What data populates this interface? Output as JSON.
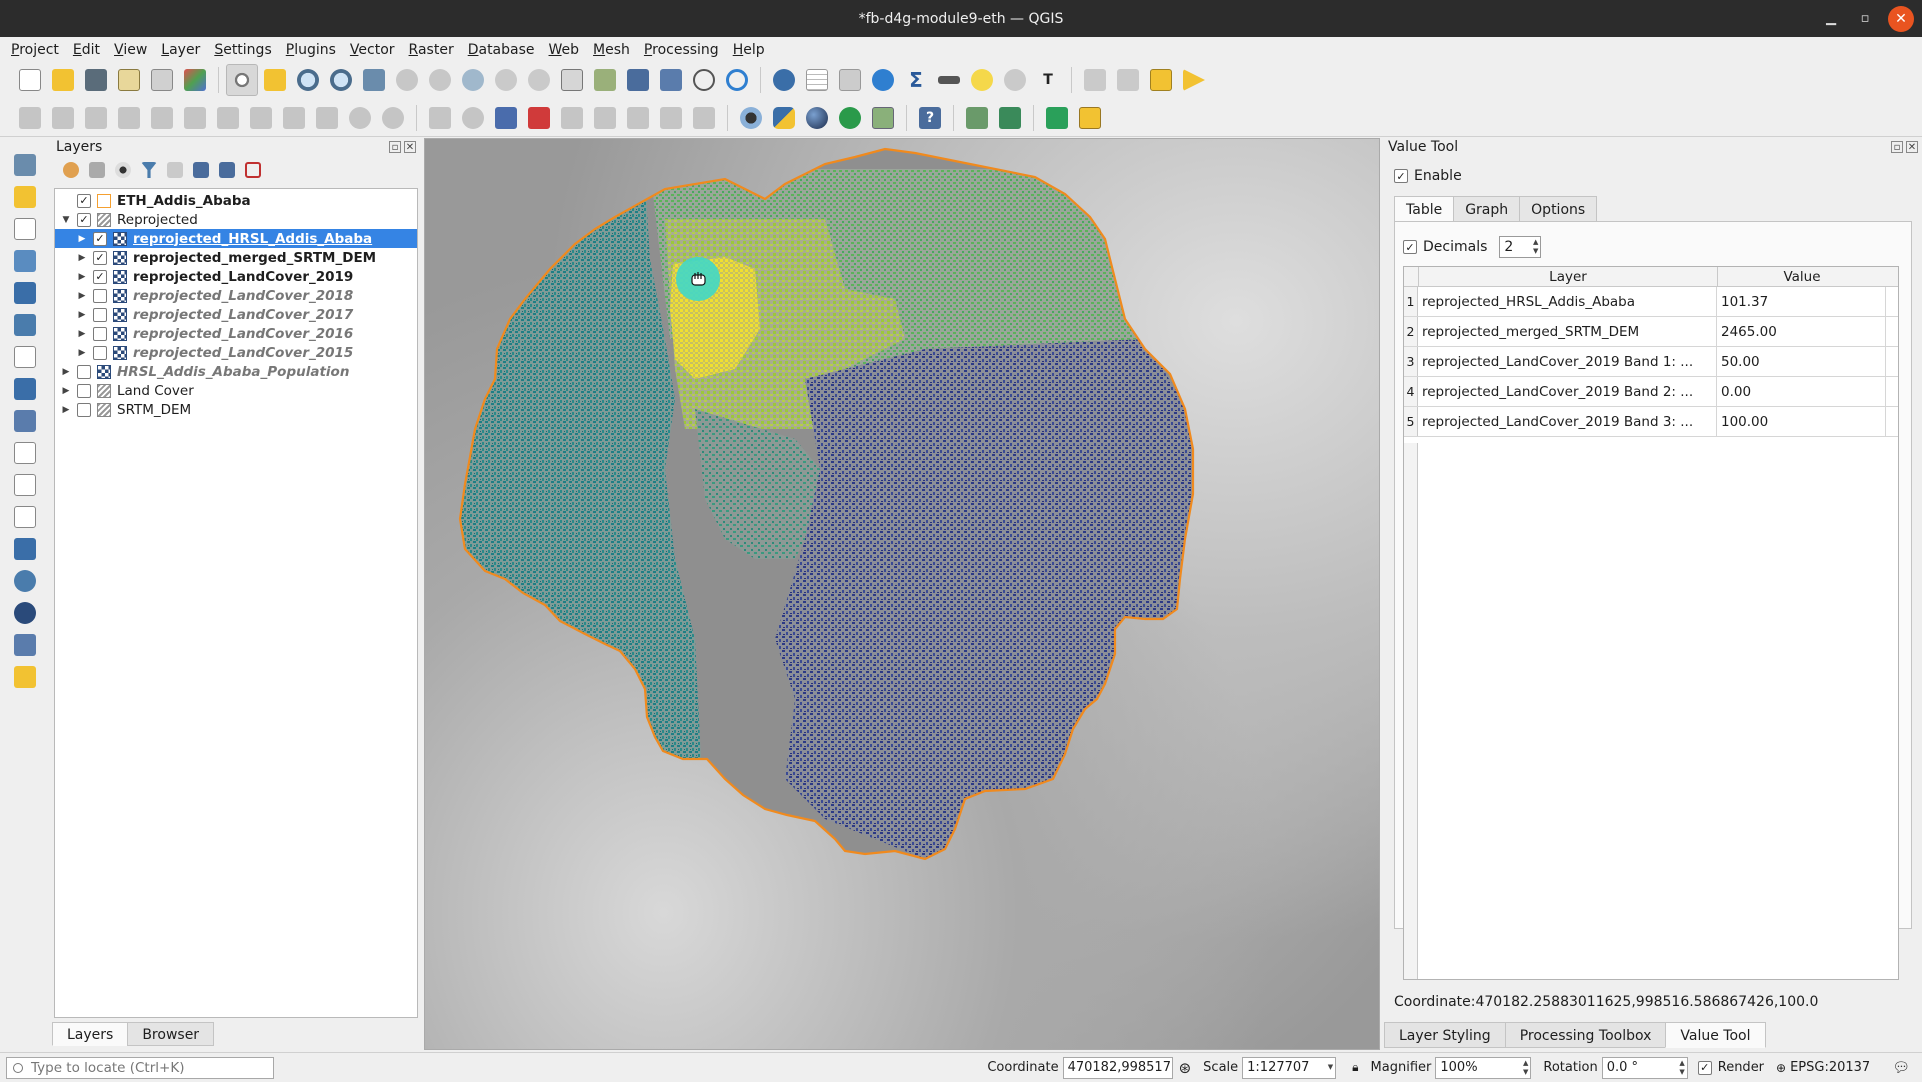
{
  "window": {
    "title": "*fb-d4g-module9-eth — QGIS"
  },
  "menu": [
    "Project",
    "Edit",
    "View",
    "Layer",
    "Settings",
    "Plugins",
    "Vector",
    "Raster",
    "Database",
    "Web",
    "Mesh",
    "Processing",
    "Help"
  ],
  "layers_panel": {
    "title": "Layers",
    "tree": [
      {
        "name": "ETH_Addis_Ababa",
        "checked": true,
        "type": "vector",
        "style": "bold",
        "indent": 0,
        "expander": ""
      },
      {
        "name": "Reprojected",
        "checked": true,
        "type": "group",
        "style": "normal",
        "indent": 0,
        "expander": "▼"
      },
      {
        "name": "reprojected_HRSL_Addis_Ababa",
        "checked": true,
        "type": "raster",
        "style": "bold",
        "indent": 1,
        "expander": "▶",
        "selected": true
      },
      {
        "name": "reprojected_merged_SRTM_DEM",
        "checked": true,
        "type": "raster",
        "style": "bold",
        "indent": 1,
        "expander": "▶"
      },
      {
        "name": "reprojected_LandCover_2019",
        "checked": true,
        "type": "raster",
        "style": "bold",
        "indent": 1,
        "expander": "▶"
      },
      {
        "name": "reprojected_LandCover_2018",
        "checked": false,
        "type": "raster",
        "style": "italic",
        "indent": 1,
        "expander": "▶"
      },
      {
        "name": "reprojected_LandCover_2017",
        "checked": false,
        "type": "raster",
        "style": "italic",
        "indent": 1,
        "expander": "▶"
      },
      {
        "name": "reprojected_LandCover_2016",
        "checked": false,
        "type": "raster",
        "style": "italic",
        "indent": 1,
        "expander": "▶"
      },
      {
        "name": "reprojected_LandCover_2015",
        "checked": false,
        "type": "raster",
        "style": "italic",
        "indent": 1,
        "expander": "▶"
      },
      {
        "name": "HRSL_Addis_Ababa_Population",
        "checked": false,
        "type": "raster",
        "style": "italic",
        "indent": 0,
        "expander": "▶"
      },
      {
        "name": "Land Cover",
        "checked": false,
        "type": "group",
        "style": "normal",
        "indent": 0,
        "expander": "▶"
      },
      {
        "name": "SRTM_DEM",
        "checked": false,
        "type": "group",
        "style": "normal",
        "indent": 0,
        "expander": "▶"
      }
    ],
    "tabs": [
      "Layers",
      "Browser"
    ]
  },
  "value_tool": {
    "title": "Value Tool",
    "enable_label": "Enable",
    "tabs": [
      "Table",
      "Graph",
      "Options"
    ],
    "decimals_label": "Decimals",
    "decimals_value": "2",
    "columns": [
      "Layer",
      "Value"
    ],
    "rows": [
      {
        "idx": "1",
        "layer": "reprojected_HRSL_Addis_Ababa",
        "value": "101.37"
      },
      {
        "idx": "2",
        "layer": "reprojected_merged_SRTM_DEM",
        "value": "2465.00"
      },
      {
        "idx": "3",
        "layer": "reprojected_LandCover_2019 Band 1: ...",
        "value": "50.00"
      },
      {
        "idx": "4",
        "layer": "reprojected_LandCover_2019 Band 2: ...",
        "value": "0.00"
      },
      {
        "idx": "5",
        "layer": "reprojected_LandCover_2019 Band 3: ...",
        "value": "100.00"
      }
    ],
    "coordinate_text": "Coordinate:470182.25883011625,998516.586867426,100.0"
  },
  "dock_tabs": [
    "Layer Styling",
    "Processing Toolbox",
    "Value Tool"
  ],
  "statusbar": {
    "locator_placeholder": "Type to locate (Ctrl+K)",
    "coordinate_label": "Coordinate",
    "coordinate_value": "470182,998517",
    "scale_label": "Scale",
    "scale_value": "1:127707",
    "magnifier_label": "Magnifier",
    "magnifier_value": "100%",
    "rotation_label": "Rotation",
    "rotation_value": "0.0 °",
    "render_label": "Render",
    "crs": "EPSG:20137"
  },
  "colors": {
    "boundary": "#f08a1e",
    "selection": "#3584e4",
    "close_button": "#e95420",
    "pan_cursor": "#40d8c8"
  }
}
